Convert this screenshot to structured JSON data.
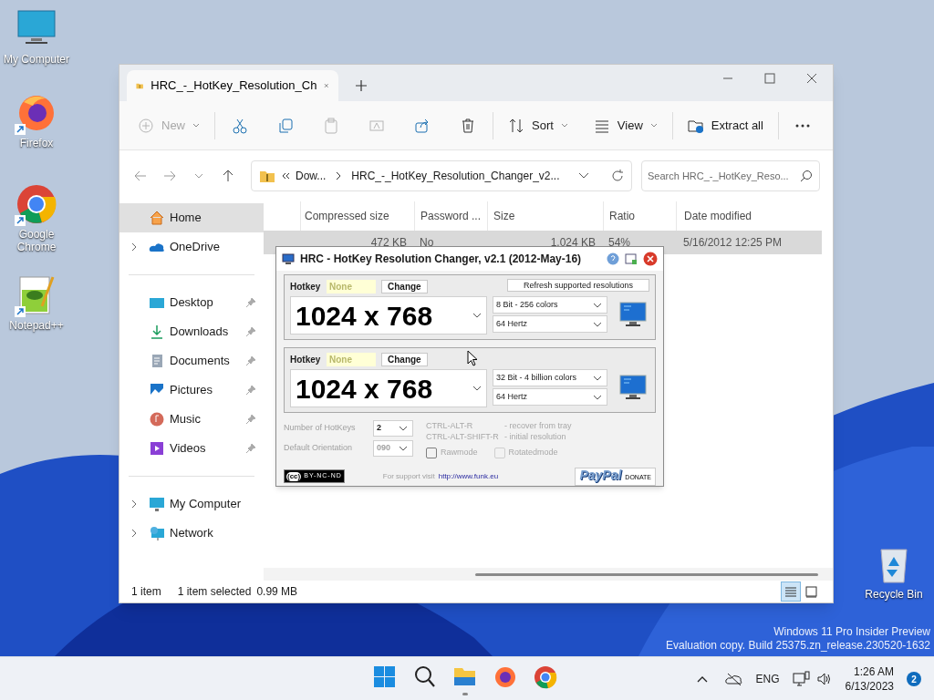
{
  "desktop_icons": [
    {
      "kind": "computer",
      "label": "My Computer",
      "shortcut": false
    },
    {
      "kind": "firefox",
      "label": "Firefox",
      "shortcut": true
    },
    {
      "kind": "chrome",
      "label": "Google Chrome",
      "shortcut": true
    },
    {
      "kind": "notepad",
      "label": "Notepad++",
      "shortcut": true
    },
    {
      "kind": "recycle",
      "label": "Recycle Bin",
      "shortcut": false
    }
  ],
  "explorer": {
    "tab": {
      "title": "HRC_-_HotKey_Resolution_Ch"
    },
    "toolbar": [
      {
        "kind": "new",
        "label": "New",
        "disabled": true
      },
      {
        "kind": "cut",
        "disabled": false
      },
      {
        "kind": "copy",
        "disabled": false
      },
      {
        "kind": "paste",
        "disabled": true
      },
      {
        "kind": "rename",
        "disabled": true
      },
      {
        "kind": "share",
        "disabled": false
      },
      {
        "kind": "delete",
        "disabled": false
      },
      {
        "kind": "sort",
        "label": "Sort",
        "disabled": false
      },
      {
        "kind": "view",
        "label": "View",
        "disabled": false
      },
      {
        "kind": "extract",
        "label": "Extract all",
        "disabled": false
      },
      {
        "kind": "more",
        "disabled": false
      }
    ],
    "crumbs": [
      "Dow...",
      "HRC_-_HotKey_Resolution_Changer_v2..."
    ],
    "search": {
      "placeholder": "Search HRC_-_HotKey_Reso..."
    },
    "sidebar": [
      {
        "kind": "home",
        "label": "Home",
        "selected": true
      },
      {
        "kind": "onedrive",
        "label": "OneDrive",
        "selected": false
      },
      {
        "kind": "desktop",
        "label": "Desktop",
        "selected": false
      },
      {
        "kind": "downloads",
        "label": "Downloads",
        "selected": false
      },
      {
        "kind": "documents",
        "label": "Documents",
        "selected": false
      },
      {
        "kind": "pictures",
        "label": "Pictures",
        "selected": false
      },
      {
        "kind": "music",
        "label": "Music",
        "selected": false
      },
      {
        "kind": "videos",
        "label": "Videos",
        "selected": false
      },
      {
        "kind": "computer",
        "label": "My Computer",
        "selected": false
      },
      {
        "kind": "network",
        "label": "Network",
        "selected": false
      }
    ],
    "columns": [
      "Compressed size",
      "Password ...",
      "Size",
      "Ratio",
      "Date modified"
    ],
    "rows": [
      {
        "cells": [
          "472 KB",
          "No",
          "1,024 KB",
          "54%",
          "5/16/2012 12:25 PM"
        ],
        "selected": true
      }
    ],
    "status": [
      "1 item",
      "1 item selected",
      "0.99 MB"
    ],
    "views": [
      {
        "kind": "details",
        "selected": true
      },
      {
        "kind": "tiles",
        "selected": false
      }
    ]
  },
  "hrc": {
    "title": "HRC - HotKey Resolution Changer, v2.1 (2012-May-16)",
    "panels": [
      {
        "hotkey_label": "Hotkey",
        "hotkey": "None",
        "change": "Change",
        "refresh": "Refresh supported resolutions",
        "resolution": "1024 x 768",
        "depth": "8 Bit - 256 colors",
        "rate": "64 Hertz"
      },
      {
        "hotkey_label": "Hotkey",
        "hotkey": "None",
        "change": "Change",
        "resolution": "1024 x 768",
        "depth": "32 Bit - 4 billion colors",
        "rate": "64 Hertz"
      }
    ],
    "count_label": "Number of HotKeys",
    "count": "2",
    "orientation_label": "Default Orientation",
    "orientation": "090",
    "orientation_disabled": true,
    "shortcuts": [
      {
        "keys": "CTRL-ALT-R",
        "desc": "- recover from tray"
      },
      {
        "keys": "CTRL-ALT-SHIFT-R",
        "desc": "- initial resolution"
      }
    ],
    "checks": [
      {
        "label": "Rawmode",
        "checked": false,
        "disabled": false
      },
      {
        "label": "Rotatedmode",
        "checked": false,
        "disabled": true
      }
    ],
    "license": "BY-NC-ND",
    "license_mark": "(cc)",
    "support": "For support visit",
    "link": "http://www.funk.eu",
    "paypal": "PayPal",
    "donate": "DONATE"
  },
  "watermark": [
    "Windows 11 Pro Insider Preview",
    "Evaluation copy. Build 25375.zn_release.230520-1632"
  ],
  "taskbar": {
    "apps": [
      {
        "kind": "start",
        "running": false
      },
      {
        "kind": "search",
        "running": false
      },
      {
        "kind": "explorer",
        "running": true
      },
      {
        "kind": "firefox",
        "running": false
      },
      {
        "kind": "chrome",
        "running": false
      }
    ],
    "language": "ENG",
    "time": "1:26 AM",
    "date": "6/13/2023",
    "notifications": "2"
  }
}
